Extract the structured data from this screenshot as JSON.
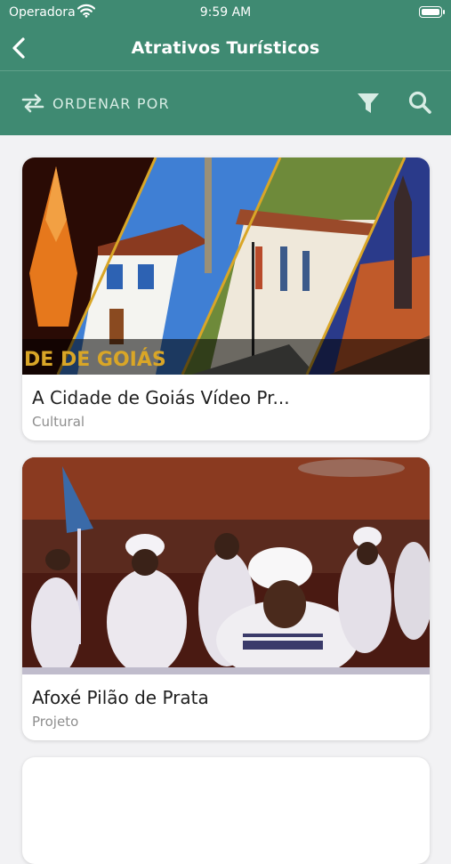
{
  "status_bar": {
    "carrier": "Operadora",
    "time": "9:59 AM"
  },
  "nav": {
    "title": "Atrativos Turísticos",
    "back_icon": "chevron-left-icon"
  },
  "toolbar": {
    "sort_label": "ORDENAR POR",
    "sort_icon": "swap-arrows-icon",
    "filter_icon": "filter-icon",
    "search_icon": "search-icon"
  },
  "cards": [
    {
      "title": "A Cidade de Goiás Vídeo Pr...",
      "category": "Cultural",
      "image_banner_text": "DE DE GOIÁS"
    },
    {
      "title": "Afoxé Pilão de Prata",
      "category": "Projeto"
    },
    {
      "title": "",
      "category": ""
    }
  ],
  "colors": {
    "primary": "#3f8a72",
    "background": "#f2f2f4",
    "card": "#ffffff"
  }
}
